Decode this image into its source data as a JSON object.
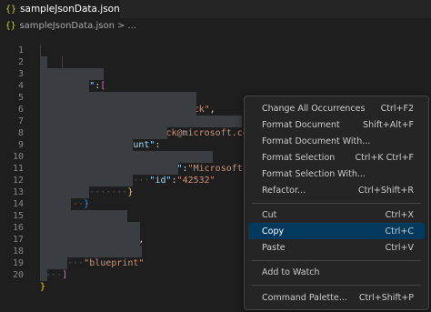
{
  "tab": {
    "icon": "{}",
    "title": "sampleJsonData.json",
    "modified_indicator": "dot"
  },
  "breadcrumb": {
    "icon": "{}",
    "file": "sampleJsonData.json",
    "separator": ">",
    "more": "..."
  },
  "editor": {
    "lines": [
      {
        "n": "1"
      },
      {
        "n": "2"
      },
      {
        "n": "3"
      },
      {
        "n": "4"
      },
      {
        "n": "5"
      },
      {
        "n": "6"
      },
      {
        "n": "7"
      },
      {
        "n": "8"
      },
      {
        "n": "9"
      },
      {
        "n": "10"
      },
      {
        "n": "11"
      },
      {
        "n": "12"
      },
      {
        "n": "13"
      },
      {
        "n": "14"
      },
      {
        "n": "15"
      },
      {
        "n": "16"
      },
      {
        "n": "17"
      },
      {
        "n": "18"
      },
      {
        "n": "19"
      },
      {
        "n": "20"
      }
    ]
  },
  "menu": {
    "items": [
      {
        "label": "Change All Occurrences",
        "shortcut": "Ctrl+F2"
      },
      {
        "label": "Format Document",
        "shortcut": "Shift+Alt+F"
      },
      {
        "label": "Format Document With...",
        "shortcut": ""
      },
      {
        "label": "Format Selection",
        "shortcut": "Ctrl+K Ctrl+F"
      },
      {
        "label": "Format Selection With...",
        "shortcut": ""
      },
      {
        "label": "Refactor...",
        "shortcut": "Ctrl+Shift+R"
      },
      {
        "label": "Cut",
        "shortcut": "Ctrl+X"
      },
      {
        "label": "Copy",
        "shortcut": "Ctrl+C"
      },
      {
        "label": "Paste",
        "shortcut": "Ctrl+V"
      },
      {
        "label": "Add to Watch",
        "shortcut": ""
      },
      {
        "label": "Command Palette...",
        "shortcut": "Ctrl+Shift+P"
      }
    ],
    "active_item": "Copy"
  },
  "colors": {
    "background": "#1e1e1e",
    "selection": "#3a3d41",
    "key": "#9cdcfe",
    "string": "#ce9178",
    "bracket_level1": "#ffd700",
    "bracket_level2": "#da70d6",
    "bracket_level3": "#179fff",
    "menu_highlight": "#04395e"
  }
}
